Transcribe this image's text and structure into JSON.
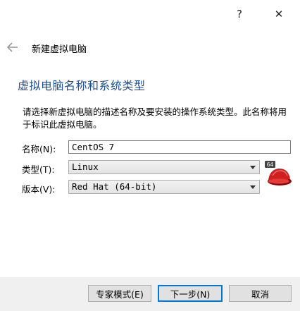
{
  "titlebar": {
    "help": "?",
    "close": "✕"
  },
  "header": {
    "title": "新建虚拟电脑"
  },
  "section": {
    "title": "虚拟电脑名称和系统类型",
    "description": "请选择新虚拟电脑的描述名称及要安装的操作系统类型。此名称将用于标识此虚拟电脑。"
  },
  "form": {
    "name_label": "名称(N):",
    "name_value": "CentOS 7",
    "type_label": "类型(T):",
    "type_value": "Linux",
    "version_label": "版本(V):",
    "version_value": "Red Hat (64-bit)"
  },
  "os_icon": {
    "badge": "64",
    "icon": "redhat-logo-icon"
  },
  "buttons": {
    "expert": "专家模式(E)",
    "next": "下一步(N)",
    "cancel": "取消"
  },
  "colors": {
    "section_title": "#1f4e8f",
    "default_button_border": "#0078d7"
  }
}
